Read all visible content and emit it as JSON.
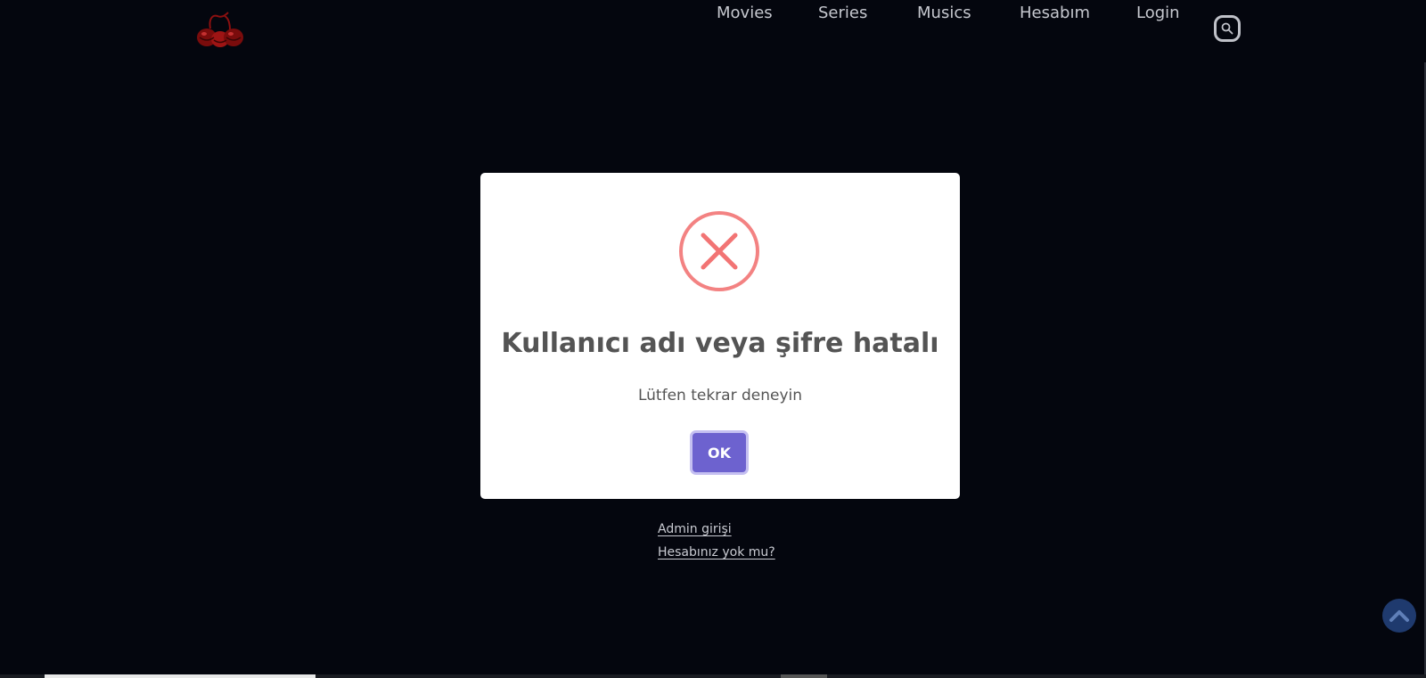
{
  "nav": {
    "logo_icon": "cherries-logo-icon",
    "movies": "Movies",
    "series": "Series",
    "musics": "Musics",
    "hesabim": "Hesabım",
    "login": "Login",
    "search_icon": "search-icon"
  },
  "links": {
    "admin": "Admin girişi",
    "no_account": "Hesabınız yok mu?"
  },
  "modal": {
    "icon": "error-x-icon",
    "title": "Kullanıcı adı veya şifre hatalı",
    "text": "Lütfen tekrar deneyin",
    "ok_label": "OK"
  },
  "scroll_top_icon": "chevron-up-icon",
  "colors": {
    "background": "#04060e",
    "error": "#f27474",
    "ok_button": "#6d62cf",
    "scroll_top": "#1f3a6e"
  }
}
